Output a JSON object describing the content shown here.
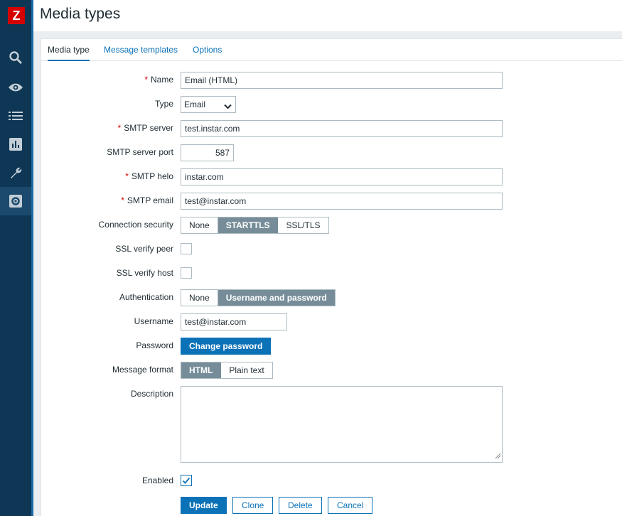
{
  "app": {
    "logo_letter": "Z"
  },
  "header": {
    "title": "Media types"
  },
  "sidebar": {
    "items": [
      {
        "name": "search",
        "icon": "search-icon"
      },
      {
        "name": "monitoring",
        "icon": "eye-icon"
      },
      {
        "name": "inventory",
        "icon": "list-icon"
      },
      {
        "name": "reports",
        "icon": "chart-icon"
      },
      {
        "name": "configuration",
        "icon": "wrench-icon"
      },
      {
        "name": "administration",
        "icon": "gear-icon",
        "active": true
      }
    ]
  },
  "tabs": [
    {
      "label": "Media type",
      "active": true
    },
    {
      "label": "Message templates"
    },
    {
      "label": "Options"
    }
  ],
  "form": {
    "name": {
      "label": "Name",
      "value": "Email (HTML)",
      "required": true
    },
    "type": {
      "label": "Type",
      "value": "Email"
    },
    "smtp_server": {
      "label": "SMTP server",
      "value": "test.instar.com",
      "required": true
    },
    "smtp_port": {
      "label": "SMTP server port",
      "value": "587"
    },
    "smtp_helo": {
      "label": "SMTP helo",
      "value": "instar.com",
      "required": true
    },
    "smtp_email": {
      "label": "SMTP email",
      "value": "test@instar.com",
      "required": true
    },
    "connection_security": {
      "label": "Connection security",
      "options": [
        "None",
        "STARTTLS",
        "SSL/TLS"
      ],
      "selected": "STARTTLS"
    },
    "ssl_verify_peer": {
      "label": "SSL verify peer",
      "checked": false
    },
    "ssl_verify_host": {
      "label": "SSL verify host",
      "checked": false
    },
    "authentication": {
      "label": "Authentication",
      "options": [
        "None",
        "Username and password"
      ],
      "selected": "Username and password"
    },
    "username": {
      "label": "Username",
      "value": "test@instar.com"
    },
    "password": {
      "label": "Password",
      "button": "Change password"
    },
    "message_format": {
      "label": "Message format",
      "options": [
        "HTML",
        "Plain text"
      ],
      "selected": "HTML"
    },
    "description": {
      "label": "Description",
      "value": ""
    },
    "enabled": {
      "label": "Enabled",
      "checked": true
    },
    "required_marker": "*"
  },
  "actions": {
    "update": "Update",
    "clone": "Clone",
    "delete": "Delete",
    "cancel": "Cancel"
  },
  "colors": {
    "sidebar": "#0e3755",
    "accent": "#0b72b8",
    "selected_segment": "#768d99",
    "required": "#d40000"
  }
}
